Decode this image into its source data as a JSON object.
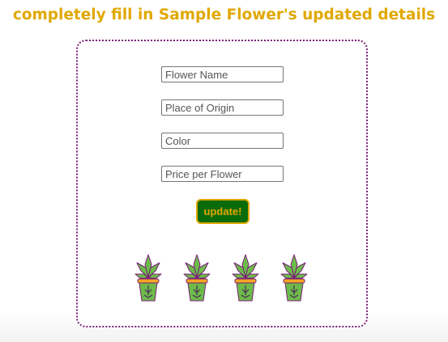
{
  "header": {
    "title": "completely fill in Sample Flower's updated details"
  },
  "form": {
    "fields": [
      {
        "placeholder": "Flower Name",
        "value": ""
      },
      {
        "placeholder": "Place of Origin",
        "value": ""
      },
      {
        "placeholder": "Color",
        "value": ""
      },
      {
        "placeholder": "Price per Flower",
        "value": ""
      }
    ],
    "submit_label": "update!"
  },
  "decorations": {
    "plant_icon": "potted-plant-icon",
    "plant_count": 4,
    "colors": {
      "leaf": "#6dbb4a",
      "leaf_outline": "#7a1f7a",
      "pot": "#6dbb4a",
      "pot_rim": "#f5a623"
    }
  },
  "colors": {
    "heading": "#e0a800",
    "button_bg": "#0a6b0a",
    "button_text": "#e0a800",
    "card_border": "#7a1f7a"
  }
}
